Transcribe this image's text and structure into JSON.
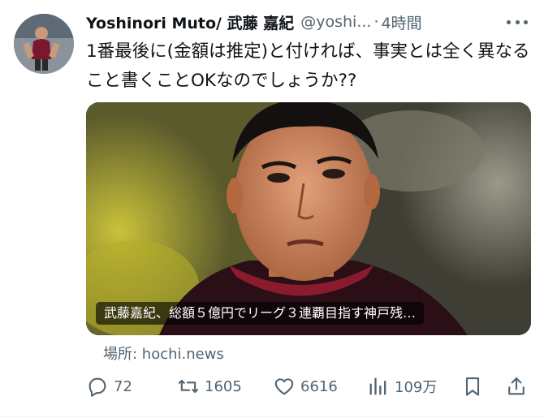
{
  "author": {
    "display_name": "Yoshinori Muto/ 武藤 嘉紀",
    "handle": "@yoshi...",
    "separator": "·",
    "time": "4時間"
  },
  "tweet": {
    "text": "1番最後に(金額は推定)と付ければ、事実とは全く異なること書くことOKなのでしょうか??"
  },
  "card": {
    "caption": "武藤嘉紀、総額５億円でリーグ３連覇目指す神戸残…",
    "source": "場所: hochi.news"
  },
  "actions": {
    "reply": {
      "icon": "reply-icon",
      "count": "72"
    },
    "retweet": {
      "icon": "retweet-icon",
      "count": "1605"
    },
    "like": {
      "icon": "heart-icon",
      "count": "6616"
    },
    "views": {
      "icon": "views-icon",
      "count": "109万"
    },
    "bookmark": {
      "icon": "bookmark-icon"
    },
    "share": {
      "icon": "share-icon"
    }
  },
  "colors": {
    "text": "#0f1419",
    "secondary": "#536471"
  }
}
